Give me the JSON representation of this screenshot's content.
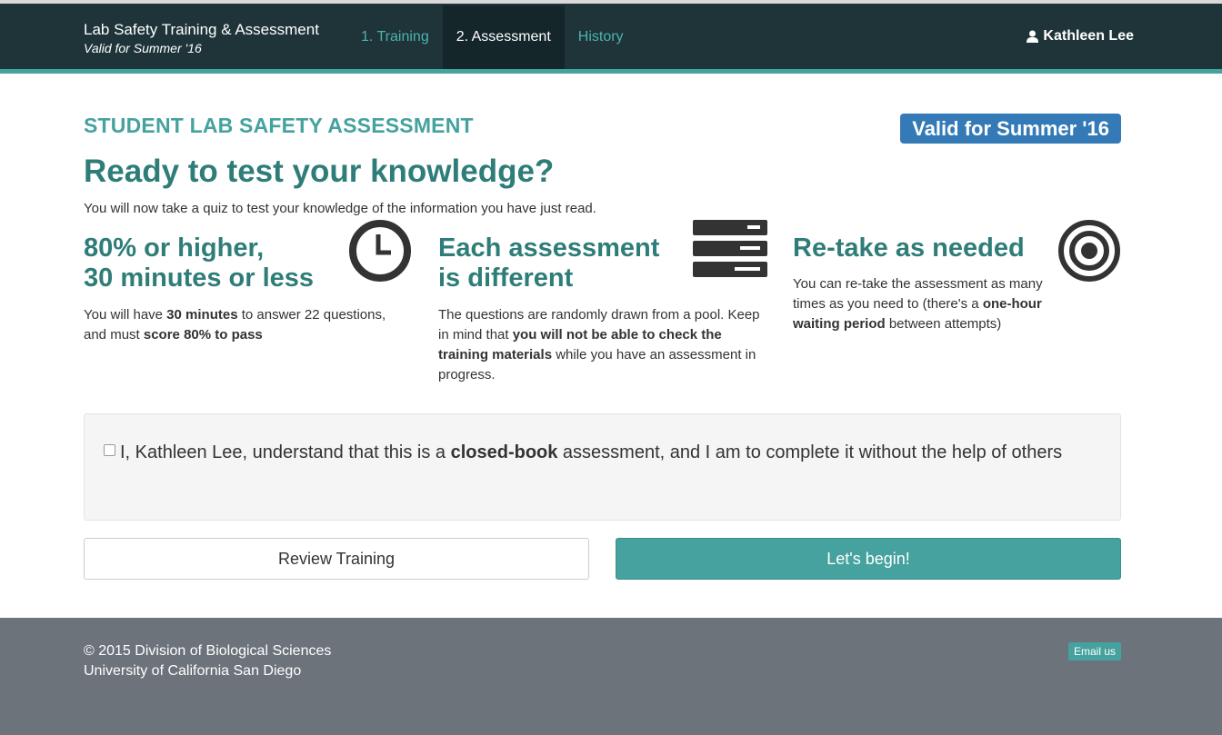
{
  "header": {
    "app_title": "Lab Safety Training & Assessment",
    "app_subtitle": "Valid for Summer '16",
    "tabs": [
      {
        "label": "1. Training"
      },
      {
        "label": "2. Assessment"
      },
      {
        "label": "History"
      }
    ],
    "active_tab": "2. Assessment",
    "user_name": "Kathleen Lee",
    "user_icon": "user-icon"
  },
  "main": {
    "eyebrow": "STUDENT LAB SAFETY ASSESSMENT",
    "valid_badge": "Valid for Summer '16",
    "headline": "Ready to test your knowledge?",
    "intro": "You will now take a quiz to test your knowledge of the information you have just read.",
    "features": [
      {
        "title_line1": "80% or higher,",
        "title_line2": "30 minutes or less",
        "icon": "clock-icon",
        "desc": [
          {
            "text": "You will have ",
            "bold": false
          },
          {
            "text": "30 minutes",
            "bold": true
          },
          {
            "text": " to answer 22 questions, and must ",
            "bold": false
          },
          {
            "text": "score 80% to pass",
            "bold": true
          }
        ]
      },
      {
        "title_line1": "Each assessment",
        "title_line2": "is different",
        "icon": "server-stack-icon",
        "desc": [
          {
            "text": "The questions are randomly drawn from a pool. Keep in mind that ",
            "bold": false
          },
          {
            "text": "you will not be able to check the training materials",
            "bold": true
          },
          {
            "text": " while you have an assessment in progress.",
            "bold": false
          }
        ]
      },
      {
        "title_line1": "Re-take as needed",
        "title_line2": "",
        "icon": "target-icon",
        "desc": [
          {
            "text": "You can re-take the assessment as many times as you need to (there's a ",
            "bold": false
          },
          {
            "text": "one-hour waiting period",
            "bold": true
          },
          {
            "text": " between attempts)",
            "bold": false
          }
        ]
      }
    ],
    "acknowledgement": [
      {
        "text": "I, Kathleen Lee, understand that this is a ",
        "bold": false
      },
      {
        "text": "closed-book",
        "bold": true
      },
      {
        "text": " assessment, and I am to complete it without the help of others",
        "bold": false
      }
    ],
    "acknowledgement_checked": false,
    "review_button": "Review Training",
    "begin_button": "Let's begin!"
  },
  "footer": {
    "line1": "© 2015 Division of Biological Sciences",
    "line2": "University of California San Diego",
    "email_button": "Email us"
  },
  "colors": {
    "navbar": "#1f3439",
    "accent": "#45a29e",
    "heading": "#2e7d78",
    "badge": "#337ab7",
    "footer": "#6c737a"
  }
}
